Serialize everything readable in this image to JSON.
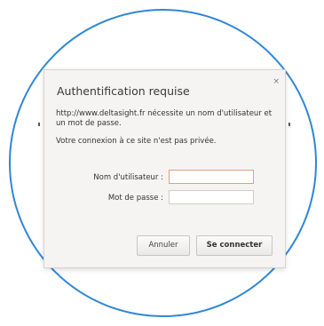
{
  "dialog": {
    "title": "Authentification requise",
    "close_glyph": "×",
    "description": "http://www.deltasight.fr nécessite un nom d'utilisateur et un mot de passe.",
    "privacy_note": "Votre connexion à ce site n'est pas privée.",
    "username_label": "Nom d'utilisateur :",
    "username_value": "",
    "password_label": "Mot de passe :",
    "password_value": "",
    "cancel_label": "Annuler",
    "connect_label": "Se connecter"
  },
  "colors": {
    "frame_circle": "#2f86d6",
    "dialog_bg": "#f5f4f2",
    "focused_field_border": "#e79a80"
  }
}
